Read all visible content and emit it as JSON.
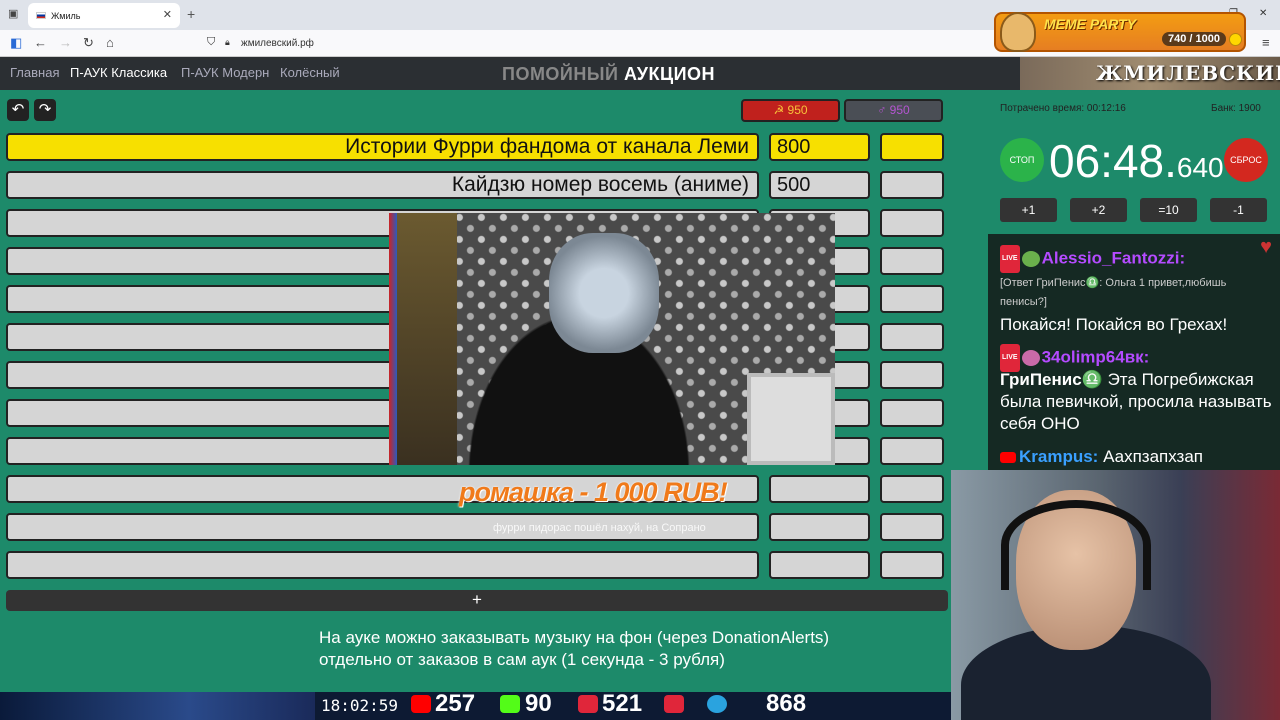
{
  "browser": {
    "tab_title": "Жмиль",
    "url": "жмилевский.рф"
  },
  "meme": {
    "title": "MEME PARTY",
    "counter": "740 / 1000"
  },
  "nav": {
    "items": [
      "Главная",
      "П-АУК Классика",
      "П-АУК Модерн",
      "Колёсный"
    ],
    "title_gray": "ПОМОЙНЫЙ",
    "title_white": "АУКЦИОН",
    "banner": "ЖМИЛЕВСКИЙ.РФ"
  },
  "totals": {
    "first": "☭ 950",
    "second": "♂ 950"
  },
  "lots": [
    {
      "name": "Истории Фурри фандома от канала Леми",
      "amount": "800"
    },
    {
      "name": "Кайдзю номер восемь (аниме)",
      "amount": "500"
    }
  ],
  "add_label": "+",
  "donation": {
    "title": "ромашка - 1 000 RUB!",
    "message": "фурри пидорас пошёл нахуй, на Сопрано"
  },
  "notice": {
    "line1": "На ауке можно заказывать музыку на фон (через DonationAlerts)",
    "line2": "отдельно от заказов в сам аук (1 секунда - 3 рубля)"
  },
  "panel": {
    "spent": "Потрачено время: 00:12:16",
    "bank": "Банк: 1900",
    "stop": "СТОП",
    "reset": "СБРОС",
    "timer_main": "06:48.",
    "timer_ms": "640",
    "buttons": [
      "+1",
      "+2",
      "=10",
      "-1"
    ]
  },
  "chat": {
    "u1": "Alessio_Fantozzi:",
    "reply": "[Ответ ГриПенис♎: Ольга 1 привет,любишь пенисы?]",
    "m1": "Покайся! Покайся во Грехах!",
    "u2": "34olimp64вк:",
    "m2_user": "ГриПенис♎",
    "m2": "Эта Погребижская была певичкой, просила называть себя ОНО",
    "u3": "Krampus:",
    "m3": "Аахпзапхзап"
  },
  "bottom": {
    "clock": "18:02:59",
    "youtube": "257",
    "kick": "90",
    "vk": "521",
    "telegram": "868"
  },
  "colors": {
    "bg": "#1d8a6a",
    "leader": "#f7e000",
    "stop": "#2bb34a",
    "reset": "#d3281f"
  }
}
